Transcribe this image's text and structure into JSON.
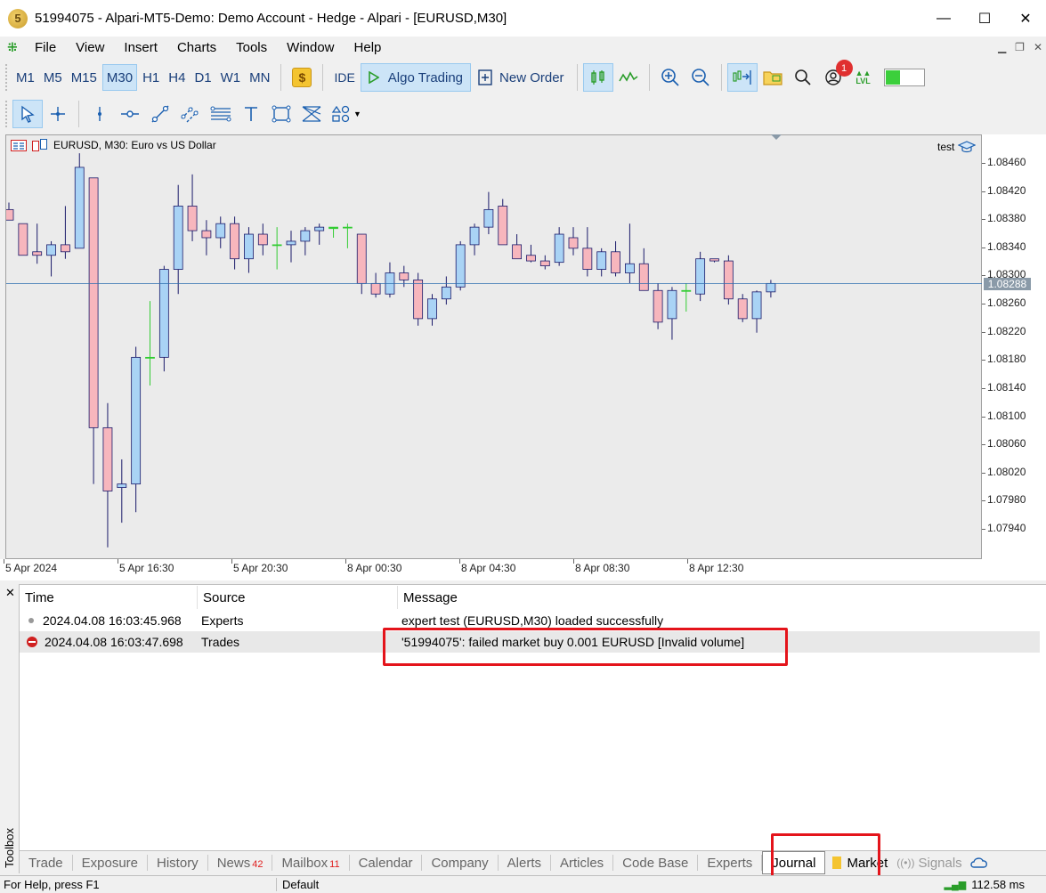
{
  "window": {
    "title": "51994075 - Alpari-MT5-Demo: Demo Account - Hedge - Alpari - [EURUSD,M30]",
    "logo": "5",
    "minimize": "—",
    "maximize": "☐",
    "close": "✕"
  },
  "menu": {
    "items": [
      "File",
      "View",
      "Insert",
      "Charts",
      "Tools",
      "Window",
      "Help"
    ]
  },
  "toolbar": {
    "timeframes": [
      "M1",
      "M5",
      "M15",
      "M30",
      "H1",
      "H4",
      "D1",
      "W1",
      "MN"
    ],
    "active_timeframe": "M30",
    "dollar": "$",
    "ide": "IDE",
    "algo_trading": "Algo Trading",
    "new_order": "New Order",
    "notification_count": "1",
    "lvl": "LVL"
  },
  "chart": {
    "header": "EURUSD, M30:  Euro vs US Dollar",
    "ea_name": "test",
    "current_price": "1.08288",
    "price_ticks": [
      "1.08460",
      "1.08420",
      "1.08380",
      "1.08340",
      "1.08300",
      "1.08260",
      "1.08220",
      "1.08180",
      "1.08140",
      "1.08100",
      "1.08060",
      "1.08020",
      "1.07980",
      "1.07940"
    ],
    "time_ticks": [
      "5 Apr 2024",
      "5 Apr 16:30",
      "5 Apr 20:30",
      "8 Apr 00:30",
      "8 Apr 04:30",
      "8 Apr 08:30",
      "8 Apr 12:30"
    ]
  },
  "chart_data": {
    "type": "candlestick",
    "symbol": "EURUSD",
    "timeframe": "M30",
    "ylim": [
      1.0791,
      1.0848
    ],
    "candles": [
      {
        "o": 1.08395,
        "h": 1.08405,
        "l": 1.0838,
        "c": 1.0838
      },
      {
        "o": 1.08375,
        "h": 1.08375,
        "l": 1.0833,
        "c": 1.0833
      },
      {
        "o": 1.08335,
        "h": 1.08375,
        "l": 1.08318,
        "c": 1.0833
      },
      {
        "o": 1.0833,
        "h": 1.0835,
        "l": 1.083,
        "c": 1.08345
      },
      {
        "o": 1.08345,
        "h": 1.084,
        "l": 1.08325,
        "c": 1.08335
      },
      {
        "o": 1.0834,
        "h": 1.08475,
        "l": 1.0834,
        "c": 1.08455
      },
      {
        "o": 1.0844,
        "h": 1.0844,
        "l": 1.08005,
        "c": 1.08085
      },
      {
        "o": 1.08085,
        "h": 1.0812,
        "l": 1.07915,
        "c": 1.07995
      },
      {
        "o": 1.08,
        "h": 1.0804,
        "l": 1.0795,
        "c": 1.08005
      },
      {
        "o": 1.08005,
        "h": 1.082,
        "l": 1.07965,
        "c": 1.08185
      },
      {
        "o": 1.08185,
        "h": 1.08265,
        "l": 1.08145,
        "c": 1.08185
      },
      {
        "o": 1.08185,
        "h": 1.08315,
        "l": 1.08165,
        "c": 1.0831
      },
      {
        "o": 1.0831,
        "h": 1.0843,
        "l": 1.08275,
        "c": 1.084
      },
      {
        "o": 1.084,
        "h": 1.08445,
        "l": 1.0835,
        "c": 1.08365
      },
      {
        "o": 1.08365,
        "h": 1.0838,
        "l": 1.0833,
        "c": 1.08355
      },
      {
        "o": 1.08355,
        "h": 1.08385,
        "l": 1.0834,
        "c": 1.08375
      },
      {
        "o": 1.08375,
        "h": 1.08385,
        "l": 1.0831,
        "c": 1.08325
      },
      {
        "o": 1.08325,
        "h": 1.0837,
        "l": 1.08305,
        "c": 1.0836
      },
      {
        "o": 1.0836,
        "h": 1.08375,
        "l": 1.0833,
        "c": 1.08345
      },
      {
        "o": 1.08345,
        "h": 1.0837,
        "l": 1.0831,
        "c": 1.08345
      },
      {
        "o": 1.08345,
        "h": 1.08365,
        "l": 1.0832,
        "c": 1.0835
      },
      {
        "o": 1.0835,
        "h": 1.0837,
        "l": 1.0833,
        "c": 1.08365
      },
      {
        "o": 1.08365,
        "h": 1.08375,
        "l": 1.08345,
        "c": 1.0837
      },
      {
        "o": 1.0837,
        "h": 1.0837,
        "l": 1.08355,
        "c": 1.08368
      },
      {
        "o": 1.0837,
        "h": 1.08375,
        "l": 1.0834,
        "c": 1.0837
      },
      {
        "o": 1.0836,
        "h": 1.0836,
        "l": 1.08275,
        "c": 1.0829
      },
      {
        "o": 1.0829,
        "h": 1.08305,
        "l": 1.0827,
        "c": 1.08275
      },
      {
        "o": 1.08275,
        "h": 1.0832,
        "l": 1.0827,
        "c": 1.08305
      },
      {
        "o": 1.08305,
        "h": 1.08315,
        "l": 1.08285,
        "c": 1.08295
      },
      {
        "o": 1.08295,
        "h": 1.08305,
        "l": 1.0823,
        "c": 1.0824
      },
      {
        "o": 1.0824,
        "h": 1.08275,
        "l": 1.0823,
        "c": 1.08268
      },
      {
        "o": 1.08268,
        "h": 1.083,
        "l": 1.0826,
        "c": 1.08285
      },
      {
        "o": 1.08285,
        "h": 1.0835,
        "l": 1.0828,
        "c": 1.08345
      },
      {
        "o": 1.08345,
        "h": 1.08375,
        "l": 1.0833,
        "c": 1.0837
      },
      {
        "o": 1.0837,
        "h": 1.0842,
        "l": 1.0836,
        "c": 1.08395
      },
      {
        "o": 1.084,
        "h": 1.0841,
        "l": 1.08345,
        "c": 1.08345
      },
      {
        "o": 1.08345,
        "h": 1.0836,
        "l": 1.08325,
        "c": 1.08325
      },
      {
        "o": 1.0833,
        "h": 1.08345,
        "l": 1.0832,
        "c": 1.08322
      },
      {
        "o": 1.08322,
        "h": 1.0833,
        "l": 1.0831,
        "c": 1.08315
      },
      {
        "o": 1.0832,
        "h": 1.0837,
        "l": 1.08315,
        "c": 1.0836
      },
      {
        "o": 1.08355,
        "h": 1.0837,
        "l": 1.0833,
        "c": 1.0834
      },
      {
        "o": 1.0834,
        "h": 1.0837,
        "l": 1.083,
        "c": 1.0831
      },
      {
        "o": 1.0831,
        "h": 1.0834,
        "l": 1.083,
        "c": 1.08335
      },
      {
        "o": 1.08335,
        "h": 1.0835,
        "l": 1.083,
        "c": 1.08305
      },
      {
        "o": 1.08305,
        "h": 1.08375,
        "l": 1.0829,
        "c": 1.08318
      },
      {
        "o": 1.08318,
        "h": 1.0834,
        "l": 1.0828,
        "c": 1.0828
      },
      {
        "o": 1.0828,
        "h": 1.0829,
        "l": 1.08225,
        "c": 1.08235
      },
      {
        "o": 1.0824,
        "h": 1.08285,
        "l": 1.0821,
        "c": 1.0828
      },
      {
        "o": 1.0828,
        "h": 1.0829,
        "l": 1.0825,
        "c": 1.0828
      },
      {
        "o": 1.08275,
        "h": 1.08335,
        "l": 1.08265,
        "c": 1.08325
      },
      {
        "o": 1.08325,
        "h": 1.08325,
        "l": 1.0832,
        "c": 1.08322
      },
      {
        "o": 1.08322,
        "h": 1.0833,
        "l": 1.0826,
        "c": 1.08268
      },
      {
        "o": 1.08268,
        "h": 1.08275,
        "l": 1.08235,
        "c": 1.0824
      },
      {
        "o": 1.0824,
        "h": 1.0828,
        "l": 1.0822,
        "c": 1.08278
      },
      {
        "o": 1.08278,
        "h": 1.08295,
        "l": 1.0827,
        "c": 1.0829
      }
    ],
    "colors": {
      "bull": "#a9d3f5",
      "bear": "#f7b6bd",
      "doji": "#33cc33",
      "wick": "#1a1a6a",
      "bid_line": "#2e6fb0"
    }
  },
  "log": {
    "headers": [
      "Time",
      "Source",
      "Message"
    ],
    "rows": [
      {
        "time": "2024.04.08 16:03:45.968",
        "source": "Experts",
        "message": "expert test (EURUSD,M30) loaded successfully",
        "level": "info"
      },
      {
        "time": "2024.04.08 16:03:47.698",
        "source": "Trades",
        "message": "'51994075': failed market buy 0.001 EURUSD [Invalid volume]",
        "level": "error"
      }
    ]
  },
  "toolbox": {
    "label": "Toolbox",
    "close": "✕",
    "tabs": [
      {
        "label": "Trade",
        "count": ""
      },
      {
        "label": "Exposure",
        "count": ""
      },
      {
        "label": "History",
        "count": ""
      },
      {
        "label": "News",
        "count": "42"
      },
      {
        "label": "Mailbox",
        "count": "11"
      },
      {
        "label": "Calendar",
        "count": ""
      },
      {
        "label": "Company",
        "count": ""
      },
      {
        "label": "Alerts",
        "count": ""
      },
      {
        "label": "Articles",
        "count": ""
      },
      {
        "label": "Code Base",
        "count": ""
      },
      {
        "label": "Experts",
        "count": ""
      },
      {
        "label": "Journal",
        "count": ""
      }
    ],
    "active_tab": "Journal",
    "market": "Market",
    "signals": "Signals"
  },
  "status": {
    "help": "For Help, press F1",
    "profile": "Default",
    "ping": "112.58 ms"
  }
}
